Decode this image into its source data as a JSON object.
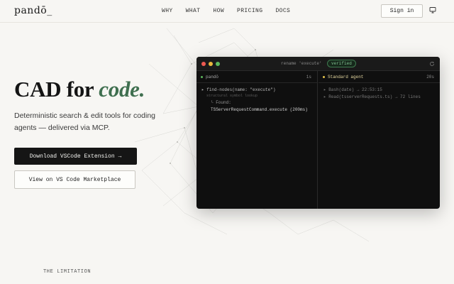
{
  "brand": {
    "logo": "pandō_"
  },
  "nav": {
    "links": [
      "WHY",
      "WHAT",
      "HOW",
      "PRICING",
      "DOCS"
    ],
    "signin_label": "Sign in"
  },
  "hero": {
    "headline_plain": "CAD for ",
    "headline_accent": "code.",
    "subtext": "Deterministic search & edit tools for coding agents — delivered via MCP.",
    "primary_cta": "Download VSCode Extension →",
    "secondary_cta": "View on VS Code Marketplace"
  },
  "terminal": {
    "title": "rename 'execute'",
    "badge": "verified",
    "left_pane": {
      "name": "pandō",
      "time": "1s",
      "lines": [
        "▸ find-nodes(name: \"execute\")",
        "structural symbol lookup",
        "└ Found:",
        "TSServerRequestCommand.execute (200ms)"
      ]
    },
    "right_pane": {
      "name": "Standard agent",
      "time": "20s",
      "lines": [
        "▸ Bash(date) → 22:53:15",
        "▸ Read(tsserverRequests.ts) → 72 lines"
      ]
    }
  },
  "section": {
    "label": "THE LIMITATION"
  },
  "colors": {
    "background": "#f7f6f3",
    "accent_green": "#3f6f4f",
    "terminal_bg": "#0f0f0f",
    "badge_green": "#7fc08f",
    "agent_yellow": "#e2c14a"
  },
  "icons": {
    "theme_toggle": "monitor-icon",
    "refresh": "refresh-icon"
  }
}
